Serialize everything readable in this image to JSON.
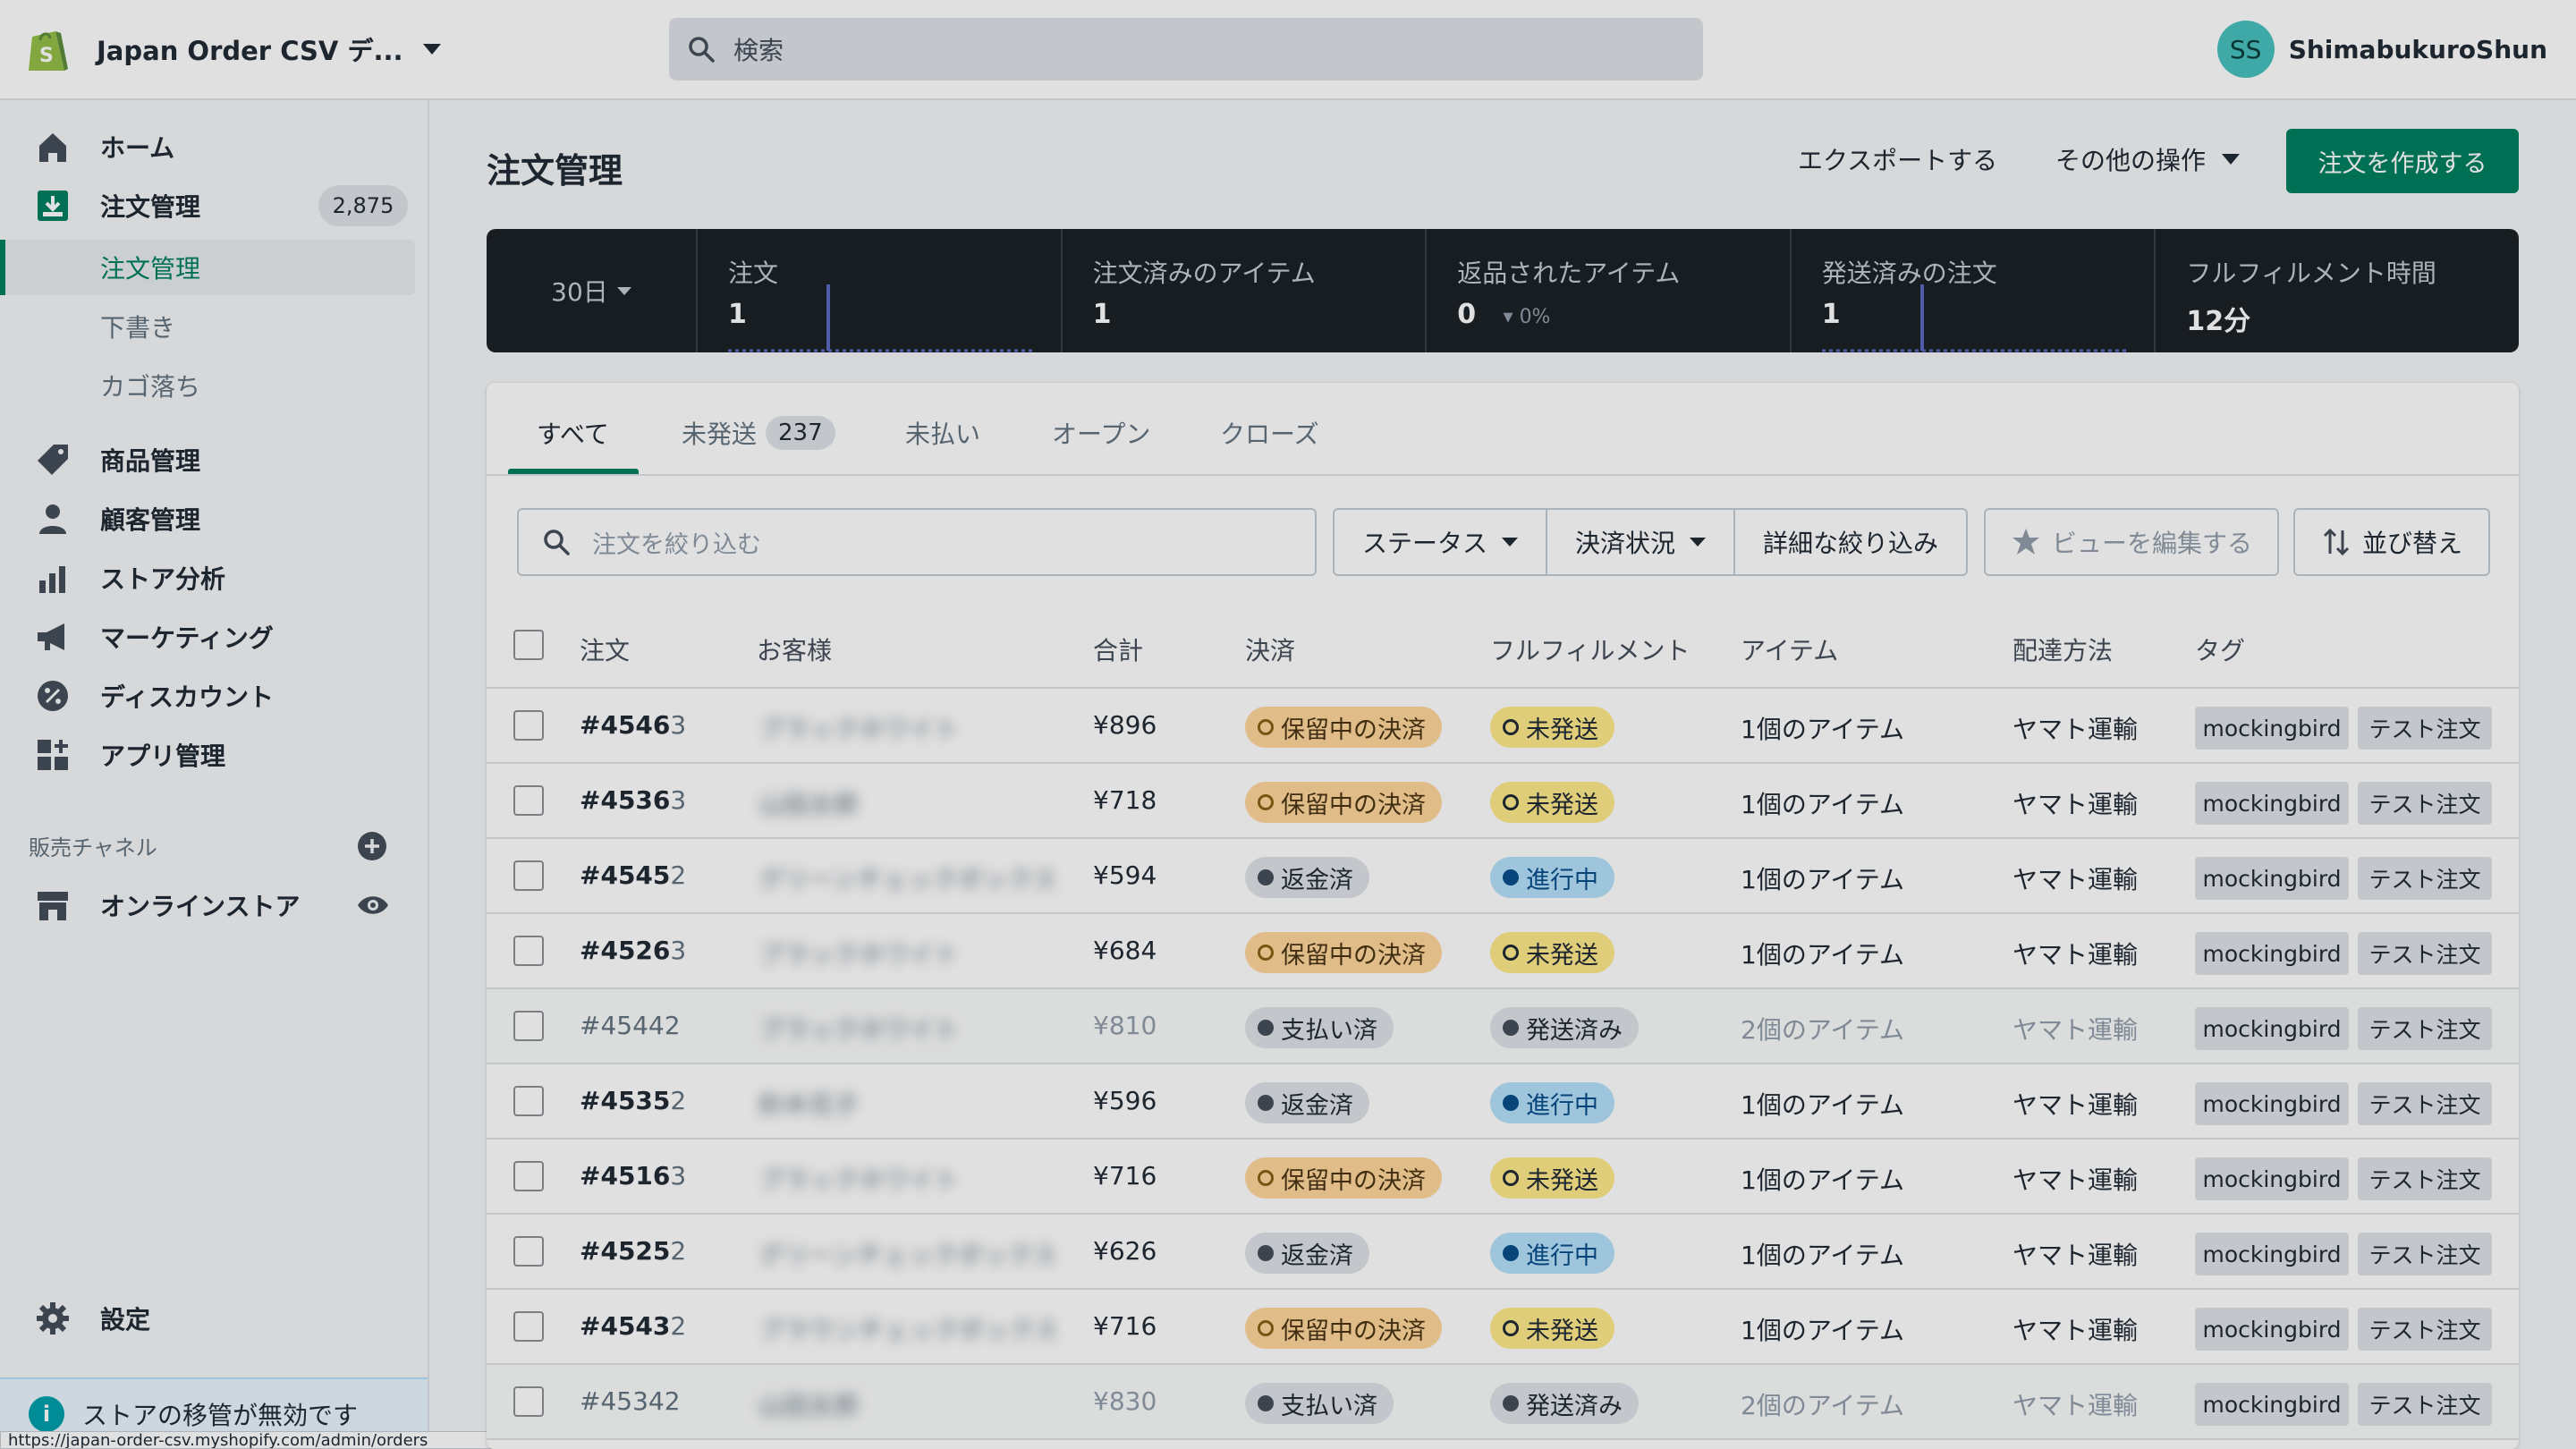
{
  "store": {
    "name": "Japan Order CSV デ..."
  },
  "search": {
    "placeholder": "検索"
  },
  "user": {
    "initials": "SS",
    "name": "ShimabukuroShun"
  },
  "sidebar": {
    "items": [
      {
        "label": "ホーム",
        "icon": "home-icon"
      },
      {
        "label": "注文管理",
        "icon": "orders-icon",
        "badge": "2,875"
      },
      {
        "label": "商品管理",
        "icon": "tag-icon"
      },
      {
        "label": "顧客管理",
        "icon": "person-icon"
      },
      {
        "label": "ストア分析",
        "icon": "analytics-icon"
      },
      {
        "label": "マーケティング",
        "icon": "megaphone-icon"
      },
      {
        "label": "ディスカウント",
        "icon": "discount-icon"
      },
      {
        "label": "アプリ管理",
        "icon": "apps-icon"
      }
    ],
    "sub_items": [
      "注文管理",
      "下書き",
      "カゴ落ち"
    ],
    "channels_label": "販売チャネル",
    "online_store": "オンラインストア",
    "settings": "設定",
    "banner": "ストアの移管が無効です",
    "status_url": "https://japan-order-csv.myshopify.com/admin/orders"
  },
  "page": {
    "title": "注文管理",
    "export": "エクスポートする",
    "more_actions": "その他の操作",
    "create": "注文を作成する"
  },
  "stats": {
    "period": "30日",
    "items": [
      {
        "label": "注文",
        "value": "1"
      },
      {
        "label": "注文済みのアイテム",
        "value": "1"
      },
      {
        "label": "返品されたアイテム",
        "value": "0",
        "change": "0%"
      },
      {
        "label": "発送済みの注文",
        "value": "1"
      },
      {
        "label": "フルフィルメント時間",
        "value": "12分"
      }
    ]
  },
  "tabs": [
    {
      "label": "すべて"
    },
    {
      "label": "未発送",
      "count": "237"
    },
    {
      "label": "未払い"
    },
    {
      "label": "オープン"
    },
    {
      "label": "クローズ"
    }
  ],
  "filters": {
    "placeholder": "注文を絞り込む",
    "status": "ステータス",
    "payment": "決済状況",
    "more": "詳細な絞り込み",
    "edit_view": "ビューを編集する",
    "sort": "並び替え"
  },
  "table": {
    "columns": [
      "注文",
      "お客様",
      "合計",
      "決済",
      "フルフィルメント",
      "アイテム",
      "配達方法",
      "タグ"
    ],
    "rows": [
      {
        "order": "#4546",
        "suffix": "3",
        "customer": "ブラックホワイト",
        "total": "¥896",
        "payment": "保留中の決済",
        "payment_type": "pending",
        "fulfillment": "未発送",
        "fulfillment_type": "unfulfilled",
        "items": "1個のアイテム",
        "delivery": "ヤマト運輸",
        "tags": [
          "mockingbird",
          "テスト注文"
        ],
        "dim": false
      },
      {
        "order": "#4536",
        "suffix": "3",
        "customer": "山田太郎",
        "total": "¥718",
        "payment": "保留中の決済",
        "payment_type": "pending",
        "fulfillment": "未発送",
        "fulfillment_type": "unfulfilled",
        "items": "1個のアイテム",
        "delivery": "ヤマト運輸",
        "tags": [
          "mockingbird",
          "テスト注文"
        ],
        "dim": false
      },
      {
        "order": "#4545",
        "suffix": "2",
        "customer": "グリーンチェックボックス",
        "total": "¥594",
        "payment": "返金済",
        "payment_type": "refunded",
        "fulfillment": "進行中",
        "fulfillment_type": "progress",
        "items": "1個のアイテム",
        "delivery": "ヤマト運輸",
        "tags": [
          "mockingbird",
          "テスト注文"
        ],
        "dim": false
      },
      {
        "order": "#4526",
        "suffix": "3",
        "customer": "ブラックホワイト",
        "total": "¥684",
        "payment": "保留中の決済",
        "payment_type": "pending",
        "fulfillment": "未発送",
        "fulfillment_type": "unfulfilled",
        "items": "1個のアイテム",
        "delivery": "ヤマト運輸",
        "tags": [
          "mockingbird",
          "テスト注文"
        ],
        "dim": false
      },
      {
        "order": "#4544",
        "suffix": "2",
        "customer": "ブラックホワイト",
        "total": "¥810",
        "payment": "支払い済",
        "payment_type": "paid",
        "fulfillment": "発送済み",
        "fulfillment_type": "shipped",
        "items": "2個のアイテム",
        "delivery": "ヤマト運輸",
        "tags": [
          "mockingbird",
          "テスト注文"
        ],
        "dim": true
      },
      {
        "order": "#4535",
        "suffix": "2",
        "customer": "鈴木花子",
        "total": "¥596",
        "payment": "返金済",
        "payment_type": "refunded",
        "fulfillment": "進行中",
        "fulfillment_type": "progress",
        "items": "1個のアイテム",
        "delivery": "ヤマト運輸",
        "tags": [
          "mockingbird",
          "テスト注文"
        ],
        "dim": false
      },
      {
        "order": "#4516",
        "suffix": "3",
        "customer": "ブラックホワイト",
        "total": "¥716",
        "payment": "保留中の決済",
        "payment_type": "pending",
        "fulfillment": "未発送",
        "fulfillment_type": "unfulfilled",
        "items": "1個のアイテム",
        "delivery": "ヤマト運輸",
        "tags": [
          "mockingbird",
          "テスト注文"
        ],
        "dim": false
      },
      {
        "order": "#4525",
        "suffix": "2",
        "customer": "グリーンチェックボックス",
        "total": "¥626",
        "payment": "返金済",
        "payment_type": "refunded",
        "fulfillment": "進行中",
        "fulfillment_type": "progress",
        "items": "1個のアイテム",
        "delivery": "ヤマト運輸",
        "tags": [
          "mockingbird",
          "テスト注文"
        ],
        "dim": false
      },
      {
        "order": "#4543",
        "suffix": "2",
        "customer": "ブラウンチェックボックス",
        "total": "¥716",
        "payment": "保留中の決済",
        "payment_type": "pending",
        "fulfillment": "未発送",
        "fulfillment_type": "unfulfilled",
        "items": "1個のアイテム",
        "delivery": "ヤマト運輸",
        "tags": [
          "mockingbird",
          "テスト注文"
        ],
        "dim": false
      },
      {
        "order": "#4534",
        "suffix": "2",
        "customer": "山田太郎",
        "total": "¥830",
        "payment": "支払い済",
        "payment_type": "paid",
        "fulfillment": "発送済み",
        "fulfillment_type": "shipped",
        "items": "2個のアイテム",
        "delivery": "ヤマト運輸",
        "tags": [
          "mockingbird",
          "テスト注文"
        ],
        "dim": true
      }
    ]
  },
  "colors": {
    "accent": "#008060",
    "dark_bar": "#1c2226"
  }
}
